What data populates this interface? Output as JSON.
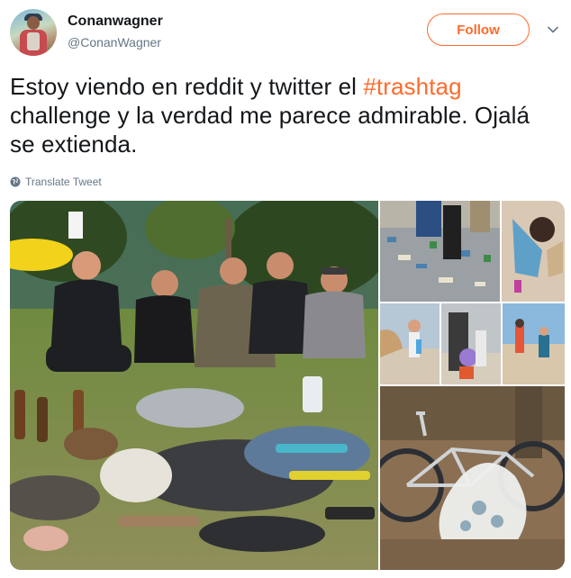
{
  "user": {
    "display_name": "Conanwagner",
    "handle": "@ConanWagner",
    "avatar_icon": "user-avatar"
  },
  "actions": {
    "follow_label": "Follow",
    "menu_icon": "chevron-down-icon"
  },
  "tweet": {
    "text_before": "Estoy viendo en reddit y twitter  el ",
    "hashtag": "#trashtag",
    "text_after": " challenge y la verdad me parece admirable. Ojalá se extienda.",
    "translate_label": "Translate Tweet",
    "translate_icon": "globe-icon"
  },
  "colors": {
    "accent": "#ff6a2c",
    "text": "#14171a",
    "secondary": "#657786"
  },
  "media": {
    "count": 7,
    "items": [
      "group-divers-with-collected-trash",
      "beach-trash-pile",
      "child-on-beach-with-bag",
      "child-with-trash-bag",
      "child-with-bin",
      "children-on-beach",
      "bicycle-with-trash-bag"
    ]
  }
}
